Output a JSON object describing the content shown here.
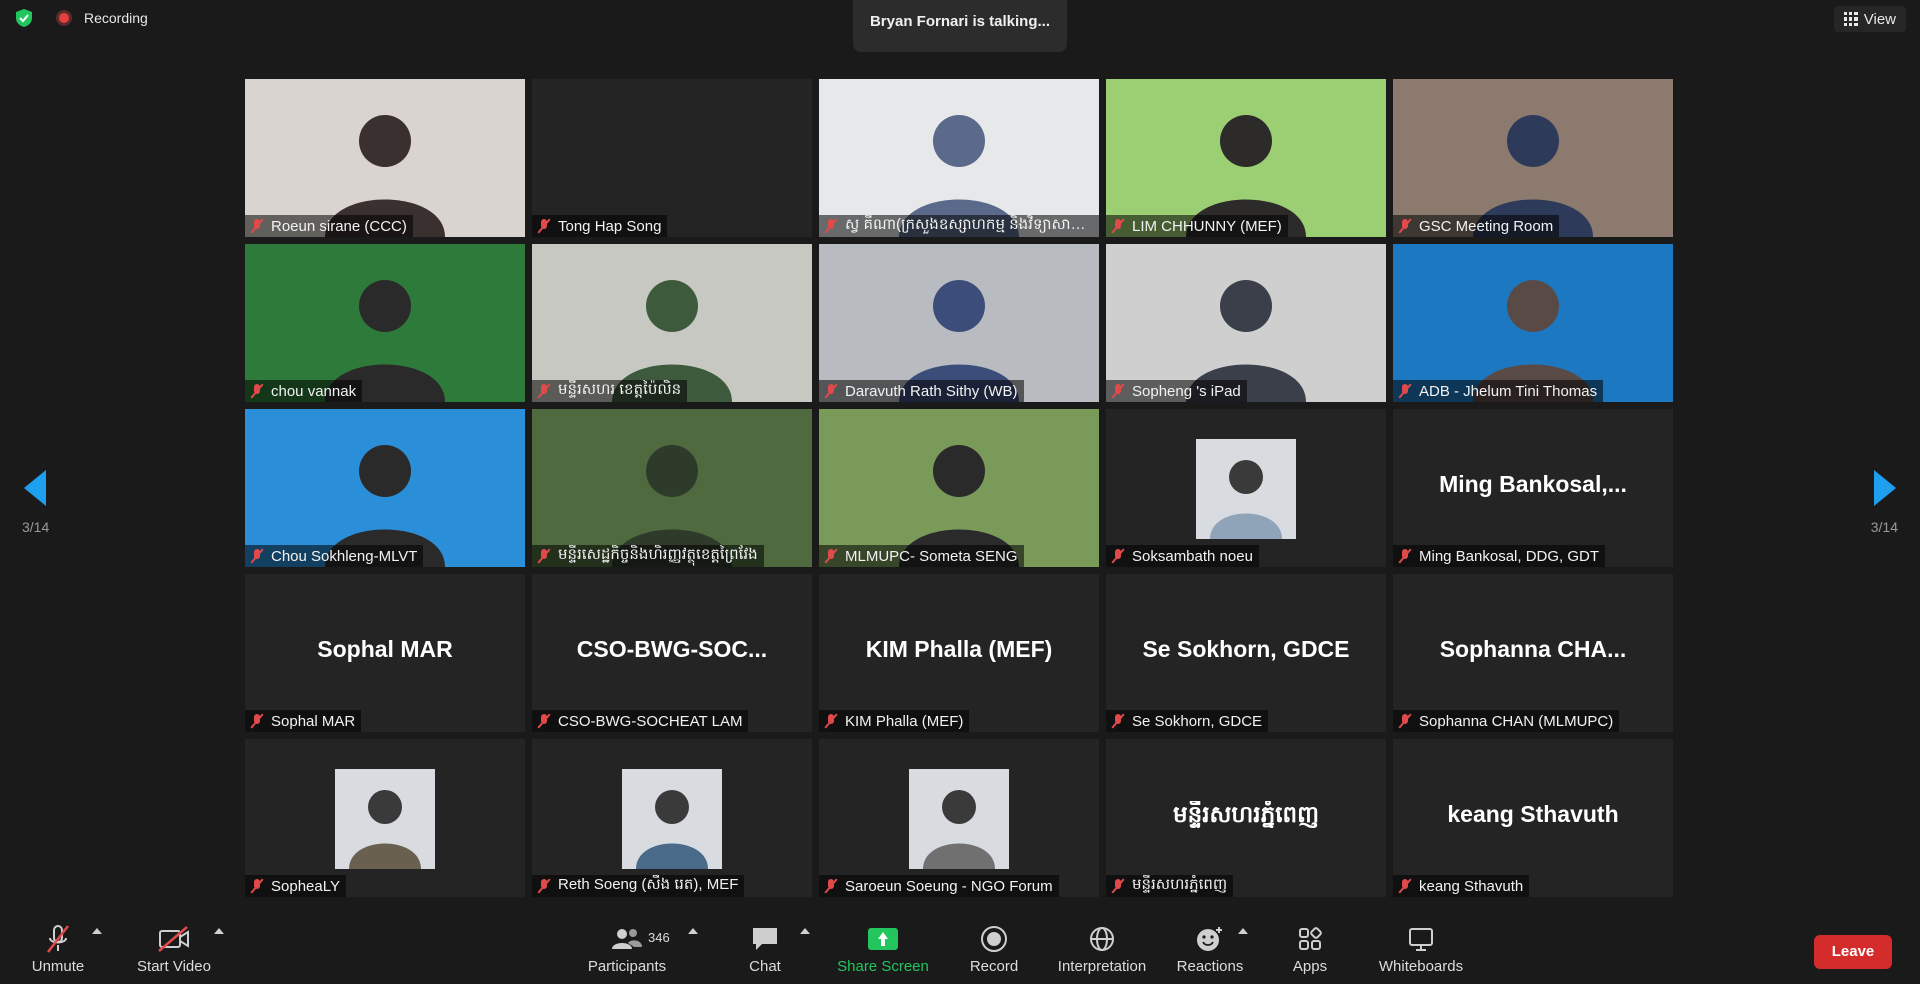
{
  "topbar": {
    "recording_label": "Recording",
    "talking_text": "Bryan Fornari is talking...",
    "view_label": "View"
  },
  "pagination": {
    "left": "3/14",
    "right": "3/14"
  },
  "tiles": [
    {
      "name": "Roeun sirane (CCC)",
      "big": "",
      "type": "video",
      "bg": "#d9d4cf",
      "fg": "#3a3030"
    },
    {
      "name": "Tong Hap Song",
      "big": "",
      "type": "empty",
      "bg": "#242424",
      "fg": "#242424"
    },
    {
      "name": "ស្វ គីណា(ក្រសួងឧស្សាហកម្ម និងវិទ្យាសាស្ត្រ)",
      "big": "",
      "type": "video",
      "bg": "#e6e8ea",
      "fg": "#5b6a8a"
    },
    {
      "name": "LIM CHHUNNY (MEF)",
      "big": "",
      "type": "video",
      "bg": "#9ccf74",
      "fg": "#2d2a2a"
    },
    {
      "name": "GSC Meeting Room",
      "big": "",
      "type": "video",
      "bg": "#8d7a6e",
      "fg": "#2e3a5a"
    },
    {
      "name": "chou vannak",
      "big": "",
      "type": "video",
      "bg": "#2d7a3a",
      "fg": "#2a2a2a"
    },
    {
      "name": "មន្ទីរសហរ ខេត្តប៉ៃលិន",
      "big": "",
      "type": "video",
      "bg": "#c8c8c2",
      "fg": "#3d5a3d"
    },
    {
      "name": "Daravuth Rath Sithy (WB)",
      "big": "",
      "type": "video",
      "bg": "#b8bcc0",
      "fg": "#3d4d7a"
    },
    {
      "name": "Sopheng 's iPad",
      "big": "",
      "type": "video",
      "bg": "#cfcfcf",
      "fg": "#3a3f4a"
    },
    {
      "name": "ADB - Jhelum Tini Thomas",
      "big": "",
      "type": "video",
      "bg": "#1d78c2",
      "fg": "#5a4a45"
    },
    {
      "name": "Chou Sokhleng-MLVT",
      "big": "",
      "type": "video",
      "bg": "#2a8fd8",
      "fg": "#2a2a2a"
    },
    {
      "name": "មន្ទីរសេដ្ឋកិច្ចនិងហិរញ្ញវត្ថុខេត្តព្រៃវែង",
      "big": "",
      "type": "video",
      "bg": "#4e6a3e",
      "fg": "#2e3a2a"
    },
    {
      "name": "MLMUPC- Someta SENG",
      "big": "",
      "type": "video",
      "bg": "#7a9a5a",
      "fg": "#2a2a2a"
    },
    {
      "name": "Soksambath noeu",
      "big": "",
      "type": "photo",
      "bg": "#242424",
      "fg": "#8fa4b8"
    },
    {
      "name": "Ming Bankosal, DDG, GDT",
      "big": "Ming  Bankosal,...",
      "type": "text",
      "bg": "#242424",
      "fg": "#242424"
    },
    {
      "name": "Sophal MAR",
      "big": "Sophal MAR",
      "type": "text",
      "bg": "#242424",
      "fg": "#242424"
    },
    {
      "name": "CSO-BWG-SOCHEAT LAM",
      "big": "CSO-BWG-SOC...",
      "type": "text",
      "bg": "#242424",
      "fg": "#242424"
    },
    {
      "name": "KIM Phalla (MEF)",
      "big": "KIM Phalla (MEF)",
      "type": "text",
      "bg": "#242424",
      "fg": "#242424"
    },
    {
      "name": "Se Sokhorn, GDCE",
      "big": "Se Sokhorn, GDCE",
      "type": "text",
      "bg": "#242424",
      "fg": "#242424"
    },
    {
      "name": "Sophanna CHAN (MLMUPC)",
      "big": "Sophanna  CHA...",
      "type": "text",
      "bg": "#242424",
      "fg": "#242424"
    },
    {
      "name": "SopheaLY",
      "big": "",
      "type": "photo",
      "bg": "#242424",
      "fg": "#6a6050"
    },
    {
      "name": "Reth Soeng (សឹង រេត), MEF",
      "big": "",
      "type": "photo",
      "bg": "#242424",
      "fg": "#4a6a8a"
    },
    {
      "name": "Saroeun Soeung - NGO Forum",
      "big": "",
      "type": "photo",
      "bg": "#242424",
      "fg": "#707070"
    },
    {
      "name": "មន្ទីរសហរភ្នំពេញ",
      "big": "មន្ទីរសហរភ្នំពេញ",
      "type": "text",
      "bg": "#242424",
      "fg": "#242424"
    },
    {
      "name": "keang Sthavuth",
      "big": "keang Sthavuth",
      "type": "text",
      "bg": "#242424",
      "fg": "#242424"
    }
  ],
  "toolbar": {
    "unmute": "Unmute",
    "start_video": "Start Video",
    "participants": "Participants",
    "participants_count": "346",
    "chat": "Chat",
    "share_screen": "Share Screen",
    "record": "Record",
    "interpretation": "Interpretation",
    "reactions": "Reactions",
    "apps": "Apps",
    "whiteboards": "Whiteboards",
    "leave": "Leave"
  },
  "colors": {
    "accent": "#1f9ff0",
    "share": "#22c55e",
    "leave": "#d42b2b",
    "muted": "#e04a4a"
  }
}
